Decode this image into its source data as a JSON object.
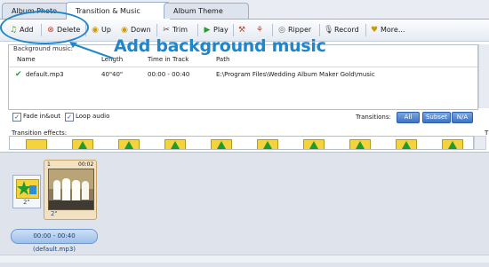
{
  "tabs": [
    "Album Photo",
    "Transition & Music",
    "Album Theme"
  ],
  "toolbar": {
    "add": "Add",
    "delete": "Delete",
    "up": "Up",
    "down": "Down",
    "trim": "Trim",
    "play": "Play",
    "ripper": "Ripper",
    "record": "Record",
    "more": "More..."
  },
  "background_music": {
    "label": "Background music:",
    "columns": [
      "Name",
      "Length",
      "Time in Track",
      "Path"
    ],
    "rows": [
      {
        "name": "default.mp3",
        "length": "40\"",
        "length_alt": "40\"",
        "time": "00:00 - 00:40",
        "path": "E:\\Program Files\\Wedding Album Maker Gold\\music"
      }
    ]
  },
  "options": {
    "fade": "Fade in&out",
    "loop": "Loop audio",
    "transitions_label": "Transitions:",
    "all": "All",
    "subset": "Subset",
    "na": "N/A"
  },
  "transition_effects_label": "Transition effects:",
  "timeline": {
    "transition_duration": "2\"",
    "clip_index": "1",
    "clip_time": "00:02",
    "clip_duration": "2\"",
    "audio_clip": "00:00 - 00:40 (default.mp3)"
  },
  "annotation": {
    "text": "Add background music"
  },
  "colors": {
    "annotation": "#1f86c9",
    "delete_icon": "#d33a2c",
    "check_icon": "#2a9a34"
  }
}
